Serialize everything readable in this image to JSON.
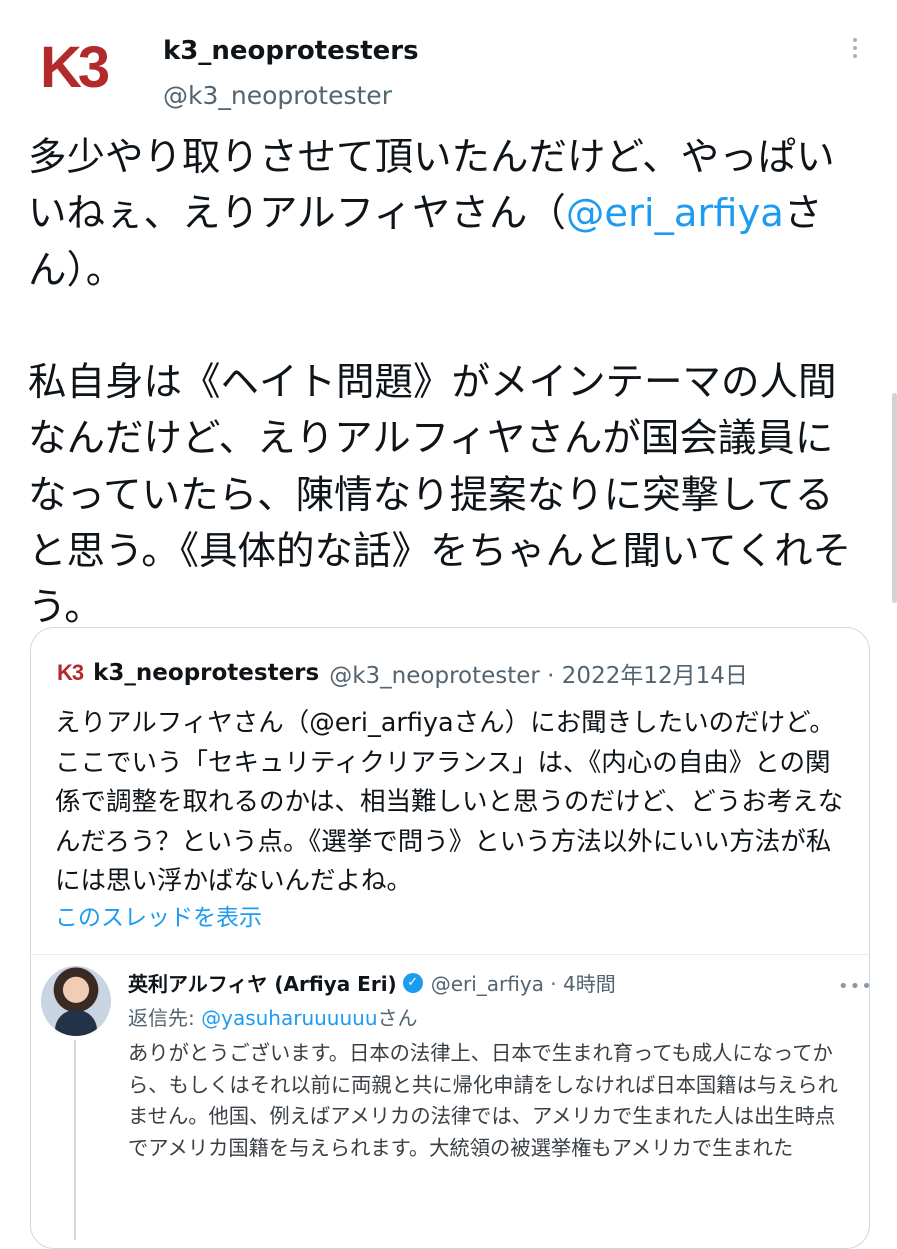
{
  "tweet": {
    "logo_text": "K3",
    "display_name": "k3_neoprotesters",
    "handle": "@k3_neoprotester",
    "body_before_mention": "多少やり取りさせて頂いたんだけど、やっぱいいねぇ、えりアルフィヤさん（",
    "body_mention": "@eri_arfiya",
    "body_after_mention": "さん）。\n\n私自身は《ヘイト問題》がメインテーマの人間なんだけど、えりアルフィヤさんが国会議員になっていたら、陳情なり提案なりに突撃してると思う。《具体的な話》をちゃんと聞いてくれそう。"
  },
  "quote": {
    "logo_text": "K3",
    "display_name": "k3_neoprotesters",
    "meta": "@k3_neoprotester · 2022年12月14日",
    "body": "えりアルフィヤさん（@eri_arfiyaさん）にお聞きしたいのだけど。ここでいう「セキュリティクリアランス」は、《内心の自由》との関係で調整を取れるのかは、相当難しいと思うのだけど、どうお考えなんだろう？という点。《選挙で問う》という方法以外にいい方法が私には思い浮かばないんだよね。",
    "show_thread_label": "このスレッドを表示"
  },
  "reply": {
    "display_name": "英利アルフィヤ (Arfiya Eri)",
    "verified_glyph": "✓",
    "meta": "@eri_arfiya · 4時間",
    "more_glyph": "•••",
    "reply_to_prefix": "返信先: ",
    "reply_to_mention": "@yasuharuuuuuu",
    "reply_to_suffix": "さん",
    "body": "ありがとうございます。日本の法律上、日本で生まれ育っても成人になってから、もしくはそれ以前に両親と共に帰化申請をしなければ日本国籍は与えられません。他国、例えばアメリカの法律では、アメリカで生まれた人は出生時点でアメリカ国籍を与えられます。大統領の被選挙権もアメリカで生まれた"
  },
  "colors": {
    "accent": "#1d9bf0",
    "brand": "#b22a2a",
    "muted": "#536471"
  }
}
